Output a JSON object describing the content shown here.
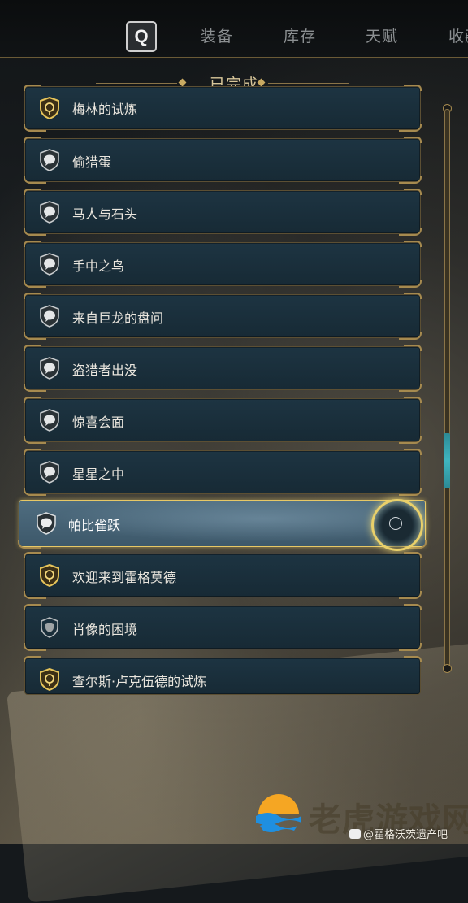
{
  "nav": {
    "key_hint": "Q",
    "tabs": [
      "装备",
      "库存",
      "天赋",
      "收藏"
    ]
  },
  "section": {
    "title": "已完成"
  },
  "quests": [
    {
      "label": "梅林的试炼",
      "icon": "gold-shield-quest-icon"
    },
    {
      "label": "偷猎蛋",
      "icon": "speech-bubble-quest-icon"
    },
    {
      "label": "马人与石头",
      "icon": "speech-bubble-quest-icon"
    },
    {
      "label": "手中之鸟",
      "icon": "speech-bubble-quest-icon"
    },
    {
      "label": "来自巨龙的盘问",
      "icon": "speech-bubble-quest-icon"
    },
    {
      "label": "盗猎者出没",
      "icon": "speech-bubble-quest-icon"
    },
    {
      "label": "惊喜会面",
      "icon": "speech-bubble-quest-icon"
    },
    {
      "label": "星星之中",
      "icon": "speech-bubble-quest-icon"
    },
    {
      "label": "帕比雀跃",
      "icon": "speech-bubble-quest-icon",
      "selected": true
    },
    {
      "label": "欢迎来到霍格莫德",
      "icon": "gold-shield-quest-icon"
    },
    {
      "label": "肖像的困境",
      "icon": "silver-shield-quest-icon"
    },
    {
      "label": "查尔斯·卢克伍德的试炼",
      "icon": "gold-shield-quest-icon"
    }
  ],
  "colors": {
    "accent_gold": "#e7c866",
    "scroll_thumb": "#3fb6c0",
    "row_bg": "#1d3442"
  },
  "watermark": {
    "site": "老虎游戏网",
    "handle": "@霍格沃茨遗产吧"
  }
}
